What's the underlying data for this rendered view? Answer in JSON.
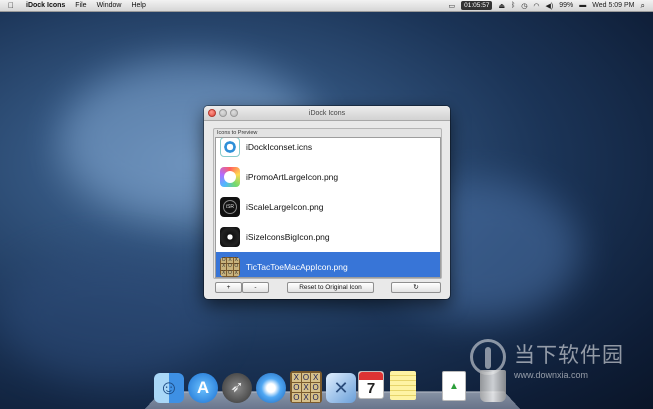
{
  "menubar": {
    "app_name": "iDock Icons",
    "menus": [
      "File",
      "Window",
      "Help"
    ],
    "timer": "01:05:57",
    "battery": "99%",
    "clock": "Wed 5:09 PM"
  },
  "window": {
    "title": "iDock Icons",
    "group_label": "Icons to Preview",
    "items": [
      {
        "label": "iDockIconset.icns",
        "icon": "idock-icon"
      },
      {
        "label": "iPromoArtLargeIcon.png",
        "icon": "ipromo-icon"
      },
      {
        "label": "iScaleLargeIcon.png",
        "icon": "iscale-icon"
      },
      {
        "label": "iSizeIconsBigIcon.png",
        "icon": "isize-icon"
      },
      {
        "label": "TicTacToeMacAppIcon.png",
        "icon": "tictactoe-icon",
        "selected": true
      }
    ],
    "buttons": {
      "add": "+",
      "remove": "-",
      "reset": "Reset to Original Icon",
      "refresh": "↻"
    }
  },
  "dock": {
    "calendar_day": "7"
  },
  "watermark": {
    "cn_text": "当下软件园",
    "url": "www.downxia.com"
  }
}
